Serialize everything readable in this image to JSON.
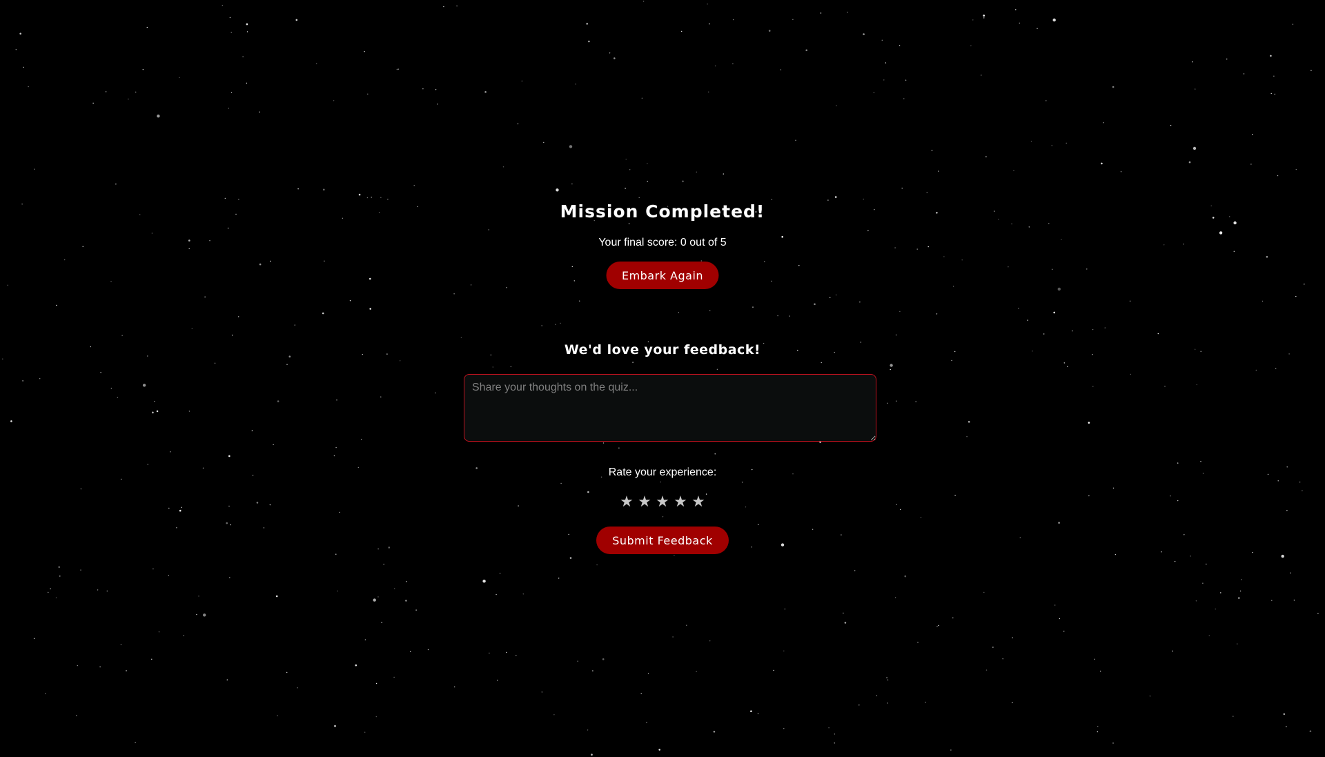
{
  "result": {
    "title": "Mission Completed!",
    "score_text": "Your final score: 0 out of 5",
    "embark_label": "Embark Again"
  },
  "feedback": {
    "title": "We'd love your feedback!",
    "placeholder": "Share your thoughts on the quiz...",
    "value": "",
    "rate_label": "Rate your experience:",
    "stars": [
      "★",
      "★",
      "★",
      "★",
      "★"
    ],
    "rating": 0,
    "submit_label": "Submit Feedback"
  },
  "colors": {
    "background": "#000000",
    "accent": "#a00000",
    "input_border": "#c1121f",
    "star": "#c8c8c8"
  }
}
